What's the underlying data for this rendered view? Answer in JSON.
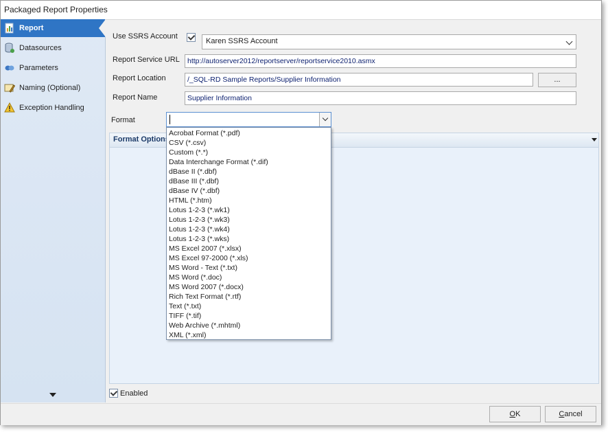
{
  "window": {
    "title": "Packaged Report Properties"
  },
  "sidebar": {
    "items": [
      {
        "label": "Report",
        "icon": "report-icon"
      },
      {
        "label": "Datasources",
        "icon": "database-icon"
      },
      {
        "label": "Parameters",
        "icon": "parameters-icon"
      },
      {
        "label": "Naming (Optional)",
        "icon": "naming-icon"
      },
      {
        "label": "Exception Handling",
        "icon": "warning-icon"
      }
    ]
  },
  "form": {
    "use_ssrs_label": "Use SSRS Account",
    "use_ssrs_checked": true,
    "ssrs_account_value": "Karen SSRS Account",
    "report_service_url_label": "Report  Service URL",
    "report_service_url_value": "http://autoserver2012/reportserver/reportservice2010.asmx",
    "report_location_label": "Report Location",
    "report_location_value": "/_SQL-RD Sample Reports/Supplier Information",
    "browse_label": "...",
    "report_name_label": "Report Name",
    "report_name_value": "Supplier Information",
    "format_label": "Format",
    "format_value": ""
  },
  "format_panel": {
    "title": "Format Options"
  },
  "format_options": [
    "Acrobat Format (*.pdf)",
    "CSV (*.csv)",
    "Custom (*.*)",
    "Data Interchange Format (*.dif)",
    "dBase II (*.dbf)",
    "dBase III (*.dbf)",
    "dBase IV (*.dbf)",
    "HTML (*.htm)",
    "Lotus 1-2-3 (*.wk1)",
    "Lotus 1-2-3 (*.wk3)",
    "Lotus 1-2-3 (*.wk4)",
    "Lotus 1-2-3 (*.wks)",
    "MS Excel 2007 (*.xlsx)",
    "MS Excel 97-2000 (*.xls)",
    "MS Word - Text (*.txt)",
    "MS Word (*.doc)",
    "MS Word 2007 (*.docx)",
    "Rich Text Format (*.rtf)",
    "Text (*.txt)",
    "TIFF (*.tif)",
    "Web Archive (*.mhtml)",
    "XML (*.xml)"
  ],
  "enabled": {
    "label": "Enabled",
    "checked": true
  },
  "buttons": {
    "ok_first": "O",
    "ok_rest": "K",
    "cancel_first": "C",
    "cancel_rest": "ancel"
  },
  "colors": {
    "accent": "#2f75c5",
    "sidebar_bg": "#d6e3f2",
    "panel_bg": "#e9f1fa"
  }
}
